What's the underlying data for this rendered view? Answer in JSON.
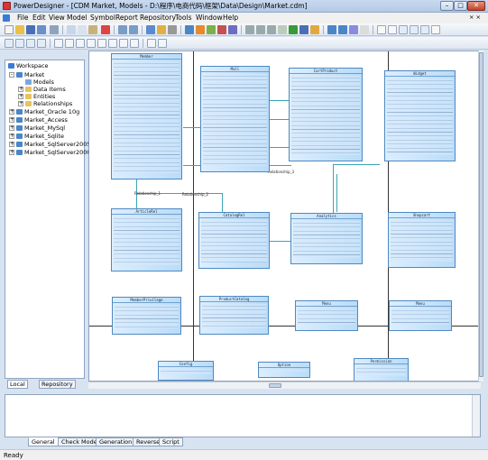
{
  "window": {
    "title": "PowerDesigner - [CDM Market, Models - D:\\程序\\电商代码\\框架\\Data\\Design\\Market.cdm]",
    "min_label": "–",
    "max_label": "□",
    "close_label": "✕",
    "inner_close_label": "× ×"
  },
  "menu": [
    "File",
    "Edit",
    "View",
    "Model",
    "Symbol",
    "Report",
    "Repository",
    "Tools",
    "Window",
    "Help"
  ],
  "tree": {
    "items": [
      {
        "label": "Workspace",
        "icon": "workspace-icon"
      },
      {
        "label": "Market",
        "icon": "model-icon"
      },
      {
        "label": "Models",
        "icon": "diagram-icon"
      },
      {
        "label": "Data Items",
        "icon": "folder-icon"
      },
      {
        "label": "Entities",
        "icon": "folder-icon"
      },
      {
        "label": "Relationships",
        "icon": "folder-icon"
      },
      {
        "label": "Market_Oracle 10g",
        "icon": "model-icon"
      },
      {
        "label": "Market_Access",
        "icon": "model-icon"
      },
      {
        "label": "Market_MySql",
        "icon": "model-icon"
      },
      {
        "label": "Market_Sqlite",
        "icon": "model-icon"
      },
      {
        "label": "Market_SqlServer2005",
        "icon": "model-icon"
      },
      {
        "label": "Market_SqlServer2000",
        "icon": "model-icon"
      }
    ],
    "tabs": [
      "Local",
      "Repository"
    ]
  },
  "diagram": {
    "entities": [
      "Member",
      "Mall",
      "CartProduct",
      "Widget",
      "ArticleRel",
      "CatalogRel",
      "Analytics",
      "Shopcart",
      "MemberPrivilege",
      "ProductCatalog",
      "Menu",
      "Menu",
      "Config",
      "Option",
      "Permission"
    ],
    "relationships": [
      "Relationship_1",
      "Relationship_2",
      "Relationship_3"
    ]
  },
  "output": {
    "tabs": [
      "General",
      "Check Model",
      "Generation",
      "Reverse",
      "Script"
    ]
  },
  "status": {
    "text": "Ready"
  },
  "colors": {
    "entity_fill": "#c9e4fa",
    "entity_border": "#4f88c0",
    "connector": "#3aa6b5",
    "chrome": "#d7e3f1"
  }
}
